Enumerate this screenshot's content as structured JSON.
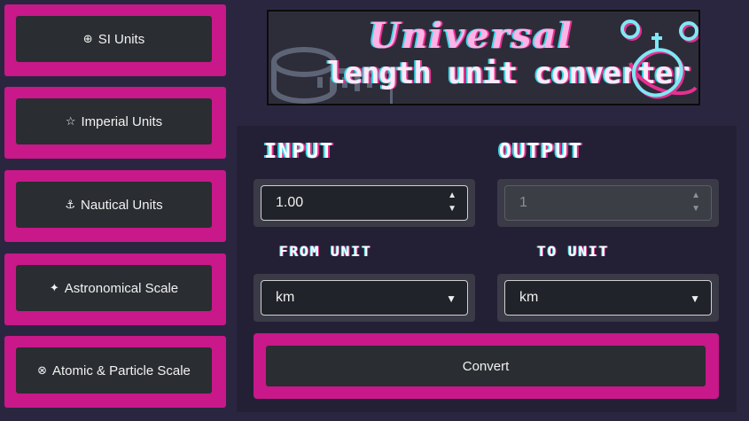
{
  "sidebar": {
    "items": [
      {
        "label": "SI Units",
        "icon": "globe-icon"
      },
      {
        "label": "Imperial Units",
        "icon": "star-icon"
      },
      {
        "label": "Nautical Units",
        "icon": "anchor-icon"
      },
      {
        "label": "Astronomical Scale",
        "icon": "sparkles-icon"
      },
      {
        "label": "Atomic & Particle Scale",
        "icon": "atom-icon"
      }
    ]
  },
  "banner": {
    "title_line1": "Universal",
    "title_line2": "length unit converter"
  },
  "converter": {
    "input_heading": "INPUT",
    "output_heading": "OUTPUT",
    "input_value": "1.00",
    "output_value": "1",
    "from_unit_heading": "FROM UNIT",
    "to_unit_heading": "TO UNIT",
    "from_unit_value": "km",
    "to_unit_value": "km",
    "convert_label": "Convert"
  },
  "colors": {
    "accent": "#c8188a",
    "background": "#2b2640",
    "panel": "#232036",
    "button": "#2a2d31"
  }
}
